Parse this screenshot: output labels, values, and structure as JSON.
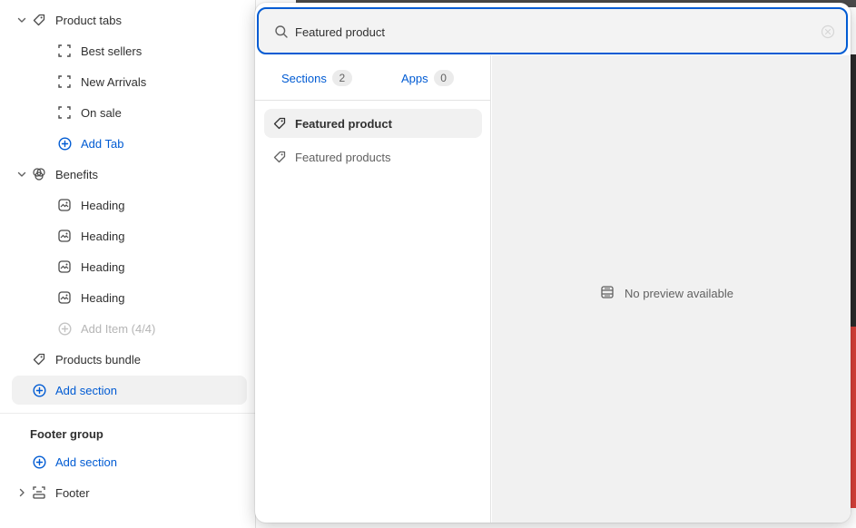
{
  "sidebar": {
    "product_tabs": {
      "label": "Product tabs",
      "children": [
        "Best sellers",
        "New Arrivals",
        "On sale"
      ],
      "add_label": "Add Tab"
    },
    "benefits": {
      "label": "Benefits",
      "children": [
        "Heading",
        "Heading",
        "Heading",
        "Heading"
      ],
      "add_label": "Add Item (4/4)"
    },
    "products_bundle_label": "Products bundle",
    "add_section_label": "Add section",
    "footer_group": {
      "title": "Footer group",
      "add_section_label": "Add section",
      "footer_label": "Footer"
    }
  },
  "search": {
    "value": "Featured product",
    "placeholder": "Search"
  },
  "tabs": [
    {
      "label": "Sections",
      "count": "2"
    },
    {
      "label": "Apps",
      "count": "0"
    }
  ],
  "results": [
    {
      "label": "Featured product",
      "selected": true
    },
    {
      "label": "Featured products",
      "selected": false
    }
  ],
  "preview": {
    "empty_label": "No preview available"
  },
  "colors": {
    "accent": "#005bd3",
    "text": "#303030",
    "muted": "#616161"
  }
}
